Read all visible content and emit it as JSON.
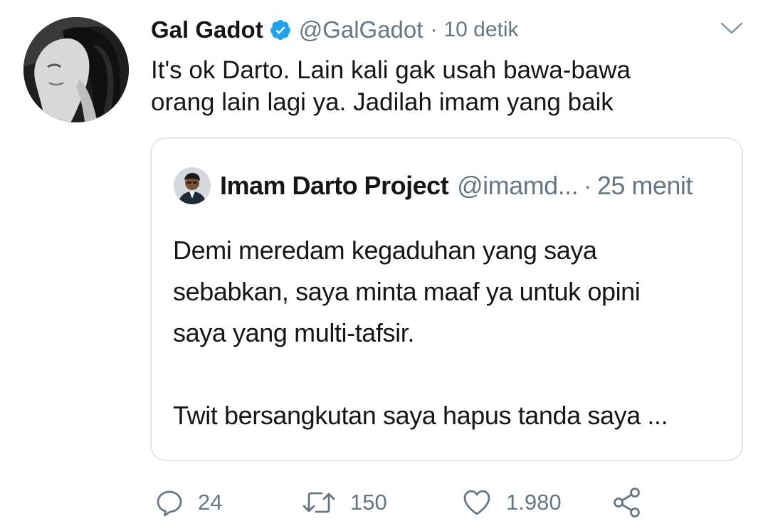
{
  "author": {
    "display_name": "Gal Gadot",
    "handle": "@GalGadot",
    "separator": "·",
    "time": "10 detik",
    "verified": true
  },
  "tweet": {
    "text": "It's ok Darto. Lain kali gak usah bawa-bawa\norang lain lagi ya. Jadilah imam yang baik"
  },
  "quoted_tweet": {
    "display_name": "Imam Darto Project",
    "handle": "@imamd...",
    "separator": "·",
    "time": "25 menit",
    "paragraph_1": "Demi meredam kegaduhan yang saya\nsebabkan, saya minta maaf ya untuk opini\nsaya yang multi-tafsir.",
    "paragraph_2": "Twit bersangkutan saya hapus tanda saya ..."
  },
  "actions": {
    "reply_count": "24",
    "retweet_count": "150",
    "like_count": "1.980"
  },
  "icons": {
    "verified": "verified-badge-icon",
    "caret": "chevron-down-icon",
    "reply": "reply-icon",
    "retweet": "retweet-icon",
    "like": "heart-icon",
    "share": "share-icon"
  },
  "colors": {
    "primary_text": "#14171a",
    "secondary_text": "#657786",
    "verified_blue": "#1da1f2",
    "card_border": "#e1e8ed"
  }
}
